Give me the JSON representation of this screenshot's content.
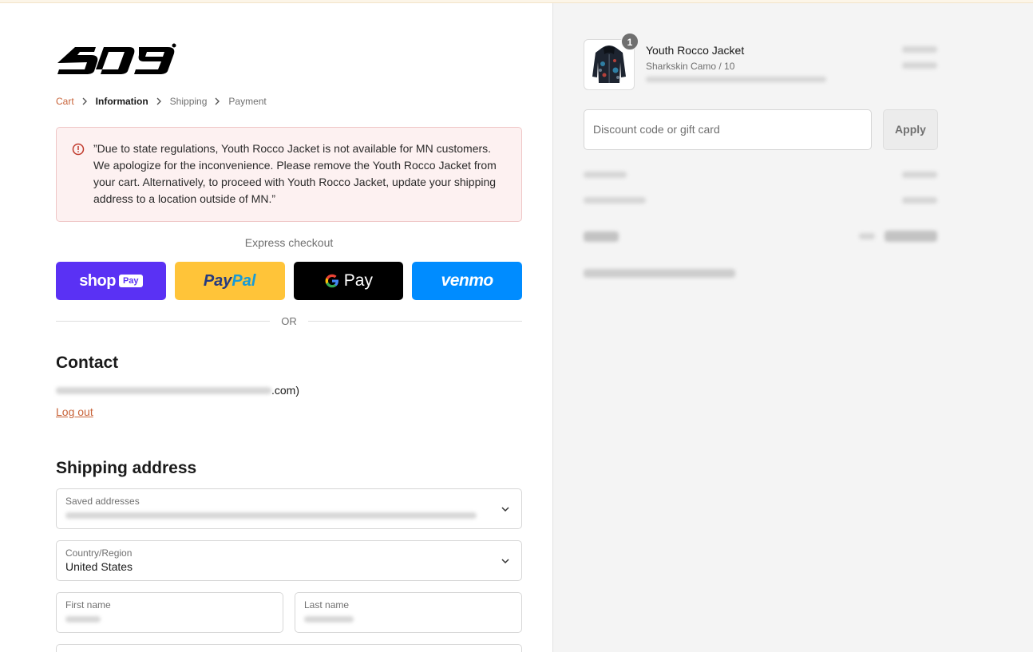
{
  "brand": {
    "logo_name": "509"
  },
  "breadcrumb": {
    "items": [
      {
        "label": "Cart",
        "state": "link"
      },
      {
        "label": "Information",
        "state": "current"
      },
      {
        "label": "Shipping",
        "state": "upcoming"
      },
      {
        "label": "Payment",
        "state": "upcoming"
      }
    ]
  },
  "alert": {
    "message": "”Due to state regulations, Youth Rocco Jacket is not available for MN customers. We apologize for the inconvenience. Please remove the Youth Rocco Jacket from your cart. Alternatively, to proceed with Youth Rocco Jacket, update your shipping address to a location outside of MN.”"
  },
  "express": {
    "title": "Express checkout",
    "shop": {
      "word": "shop",
      "badge": "Pay"
    },
    "paypal": {
      "part1": "Pay",
      "part2": "Pal"
    },
    "gpay": {
      "g": "G",
      "word": "Pay"
    },
    "venmo": {
      "word": "venmo"
    },
    "or_label": "OR"
  },
  "contact": {
    "title": "Contact",
    "email_suffix": ".com)",
    "logout_label": "Log out"
  },
  "shipping": {
    "title": "Shipping address",
    "saved_label": "Saved addresses",
    "country_label": "Country/Region",
    "country_value": "United States",
    "first_name_label": "First name",
    "last_name_label": "Last name"
  },
  "order": {
    "item_name": "Youth Rocco Jacket",
    "item_variant": "Sharkskin Camo / 10",
    "quantity": "1",
    "discount_placeholder": "Discount code or gift card",
    "apply_label": "Apply"
  },
  "colors": {
    "accent": "#c8643a",
    "alert_bg": "#fdf1f1",
    "shop_pay": "#5a31f4",
    "paypal": "#ffc439",
    "gpay": "#000000",
    "venmo": "#008cff"
  }
}
